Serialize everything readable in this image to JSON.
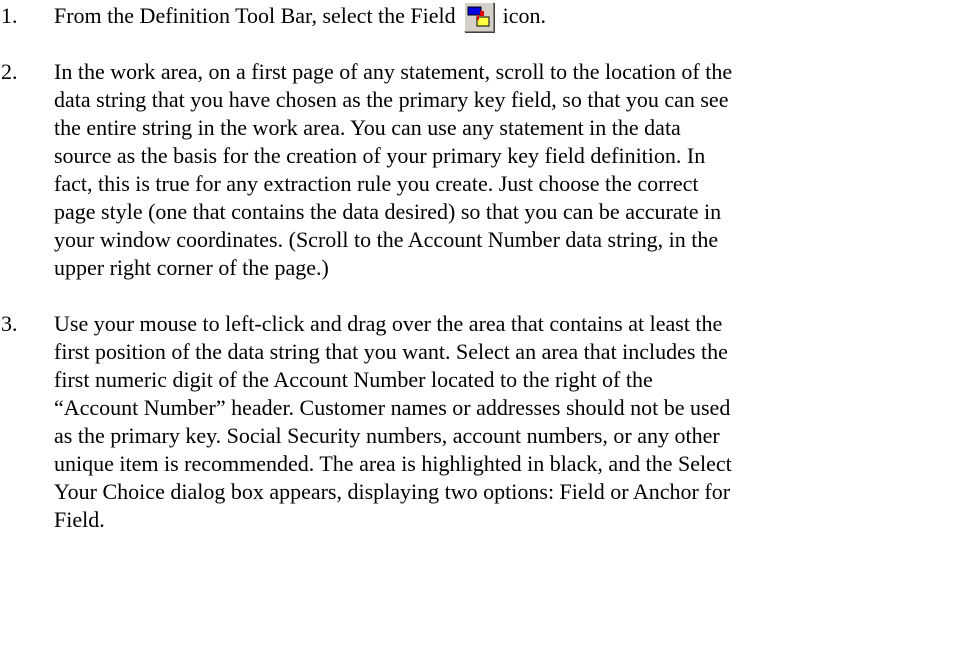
{
  "steps": [
    {
      "number": "1.",
      "lines": [
        "From the Definition Tool Bar, select the Field",
        "icon."
      ],
      "icon": "field-tool-icon"
    },
    {
      "number": "2.",
      "lines": [
        "In the work area, on a first page of any statement, scroll to the location of the",
        "data string that you have chosen as the primary key field, so that you can see",
        "the entire string in the work area. You can use any statement in the data",
        "source as the basis for the creation of your primary key field definition. In",
        "fact, this is true for any extraction rule you create. Just choose the correct",
        "page style  (one that contains the data desired) so that you can be accurate in",
        "your window coordinates. (Scroll to the Account Number data string, in the",
        "upper right corner of the page.)"
      ]
    },
    {
      "number": "3.",
      "lines": [
        "Use your mouse to left-click and drag over the area that contains at least the",
        "first position of the data string that you want. Select an area that includes the",
        "first numeric digit of the Account Number located to the right of the",
        "“Account Number” header. Customer names or addresses should not be used",
        "as the primary key. Social Security numbers, account numbers, or any other",
        "unique item is recommended. The area is highlighted in black, and the Select",
        "Your Choice dialog box appears, displaying two options: Field or Anchor for",
        "Field."
      ]
    }
  ]
}
